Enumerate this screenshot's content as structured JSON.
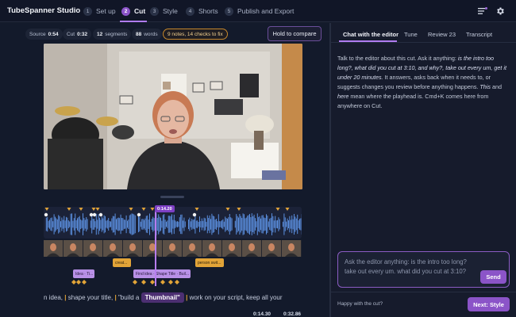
{
  "app": {
    "title": "TubeSpanner Studio"
  },
  "steps": [
    {
      "num": "1",
      "label": "Set up"
    },
    {
      "num": "2",
      "label": "Cut",
      "active": true
    },
    {
      "num": "3",
      "label": "Style"
    },
    {
      "num": "4",
      "label": "Shorts"
    },
    {
      "num": "5",
      "label": "Publish and Export"
    }
  ],
  "icons": {
    "menu": "lines-menu-icon",
    "settings": "gear-icon"
  },
  "stats": {
    "source_label": "Source",
    "source_value": "0:54",
    "cut_label": "Cut",
    "cut_value": "0:32",
    "segments_value": "12",
    "segments_label": "segments",
    "words_value": "88",
    "words_label": "words",
    "notes": "9 notes, 14 checks to fix"
  },
  "hold_button": "Hold to compare",
  "timeline": {
    "playhead_time": "0:14.20",
    "clips": {
      "c1": "creat...",
      "c2": "person swit...",
      "c3": "Idea · Ti...",
      "c4": "Find idea · Shape Title · Buil..."
    }
  },
  "transcript": {
    "w1": "n idea,",
    "w2": "shape your title,",
    "w3": "\"build a",
    "highlight": "Thumbnail\"",
    "w4": "work on your script, keep all your"
  },
  "timecodes": {
    "current": "0:14.30",
    "total": "0:32.86"
  },
  "right_panel": {
    "tabs": [
      "Chat with the editor",
      "Tune",
      "Review 23",
      "Transcript"
    ],
    "intro_1": "Talk to the editor about this cut. Ask it anything:",
    "intro_q1": "is the intro too long?, what did you cut at 3:10, and why?, take out every um, get it under 20 minutes.",
    "intro_2": "It answers, asks back when it needs to, or suggests changes you review before anything happens.",
    "intro_this": "This",
    "intro_and": "and",
    "intro_here": "here",
    "intro_3": "mean where the playhead is. Cmd+K comes here from anywhere on Cut.",
    "ask_placeholder": "Ask the editor anything: is the intro too long? take out every um. what did you cut at 3:10?",
    "send": "Send",
    "happy": "Happy with the cut?",
    "next": "Next: Style"
  },
  "colors": {
    "accent": "#8b54c8",
    "warning": "#e2a438",
    "waveform": "#5b8fe0"
  }
}
